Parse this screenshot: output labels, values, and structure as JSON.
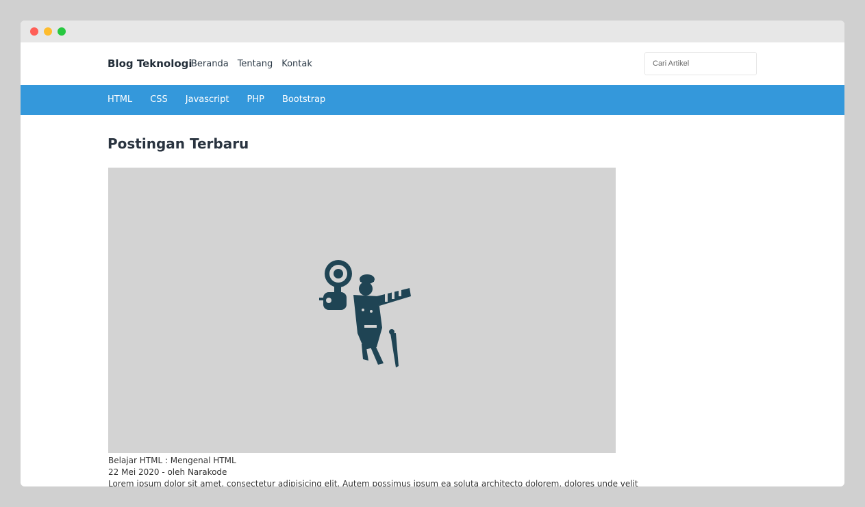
{
  "window": {
    "controls": [
      "close",
      "minimize",
      "maximize"
    ]
  },
  "header": {
    "brand": "Blog Teknologi",
    "nav": [
      {
        "label": "Beranda"
      },
      {
        "label": "Tentang"
      },
      {
        "label": "Kontak"
      }
    ],
    "search": {
      "placeholder": "Cari Artikel",
      "value": ""
    }
  },
  "categories": [
    {
      "label": "HTML"
    },
    {
      "label": "CSS"
    },
    {
      "label": "Javascript"
    },
    {
      "label": "PHP"
    },
    {
      "label": "Bootstrap"
    }
  ],
  "main": {
    "title": "Postingan Terbaru",
    "post": {
      "image_icon": "gramophone-man-illustration",
      "title": "Belajar HTML : Mengenal HTML",
      "meta": "22 Mei 2020 - oleh Narakode",
      "excerpt": "Lorem ipsum dolor sit amet, consectetur adipisicing elit. Autem possimus ipsum ea soluta architecto dolorem, dolores unde velit"
    }
  },
  "colors": {
    "accent": "#3498db",
    "image_placeholder": "#d3d3d3",
    "illustration": "#1f4454"
  }
}
